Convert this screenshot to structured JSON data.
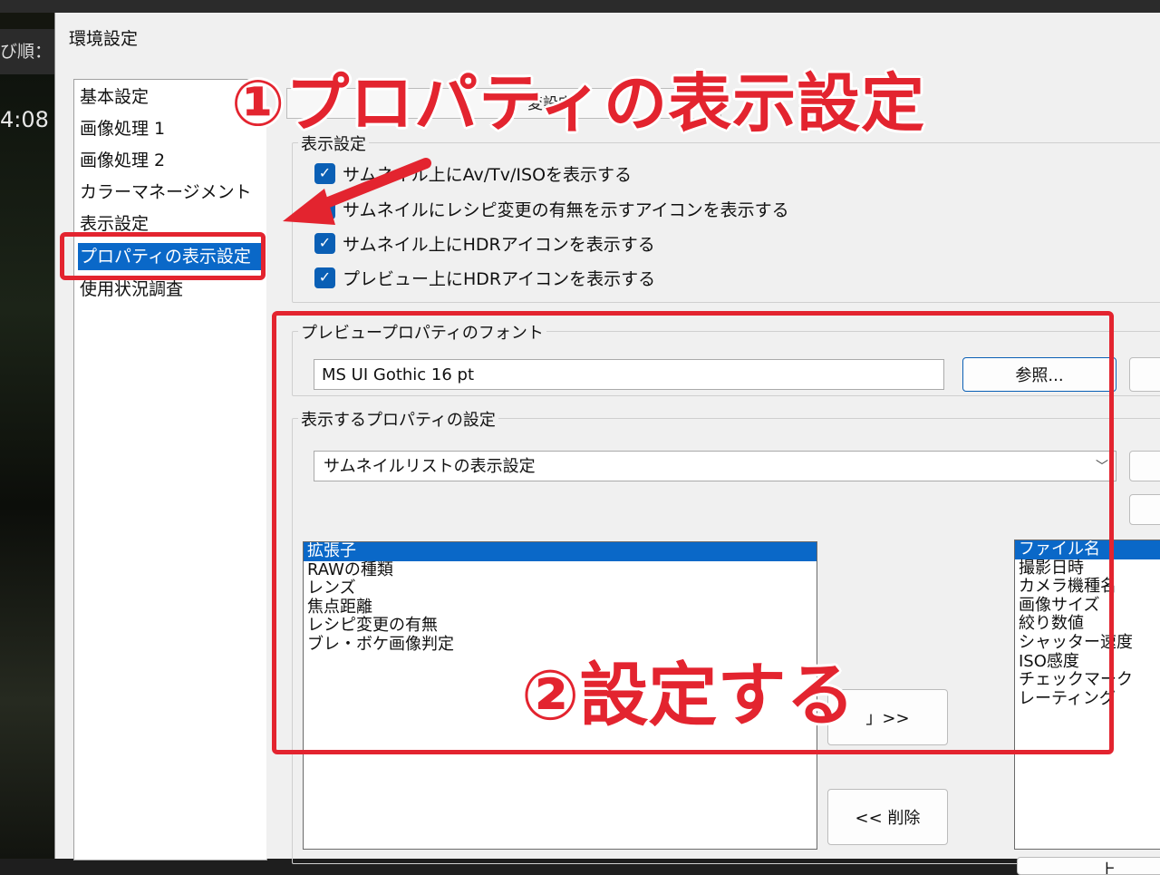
{
  "background_app": {
    "sort_label": "び順：",
    "time_text": "4:08"
  },
  "dialog": {
    "title": "環境設定",
    "nav_items": [
      {
        "label": "基本設定"
      },
      {
        "label": "画像処理 1"
      },
      {
        "label": "画像処理 2"
      },
      {
        "label": "カラーマネージメント"
      },
      {
        "label": "表示設定"
      },
      {
        "label": "プロパティの表示設定",
        "selected": true
      },
      {
        "label": "使用状況調査"
      }
    ],
    "tab_hint": "変設定",
    "display_group": {
      "label": "表示設定",
      "checkboxes": [
        {
          "label": "サムネイル上にAv/Tv/ISOを表示する",
          "checked": true
        },
        {
          "label": "サムネイルにレシピ変更の有無を示すアイコンを表示する",
          "checked": true
        },
        {
          "label": "サムネイル上にHDRアイコンを表示する",
          "checked": true
        },
        {
          "label": "プレビュー上にHDRアイコンを表示する",
          "checked": true
        }
      ]
    },
    "font_group": {
      "label": "プレビュープロパティのフォント",
      "font_value": "MS UI Gothic 16 pt",
      "browse_button": "参照..."
    },
    "props_group": {
      "label": "表示するプロパティの設定",
      "select_value": "サムネイルリストの表示設定",
      "available_items": [
        "拡張子",
        "RAWの種類",
        "レンズ",
        "焦点距離",
        "レシピ変更の有無",
        "ブレ・ボケ画像判定"
      ],
      "selected_items": [
        "ファイル名",
        "撮影日時",
        "カメラ機種名",
        "画像サイズ",
        "絞り数値",
        "シャッター速度",
        "ISO感度",
        "チェックマーク",
        "レーティング"
      ],
      "add_button": "」>>",
      "remove_button": "<< 削除",
      "partial_button": "上"
    }
  },
  "annotations": {
    "step1": "①プロパティの表示設定",
    "step2": "②設定する",
    "accent_color": "#e3242f"
  },
  "colors": {
    "selection": "#0a68c8",
    "dialog_bg": "#f0f0f0"
  }
}
